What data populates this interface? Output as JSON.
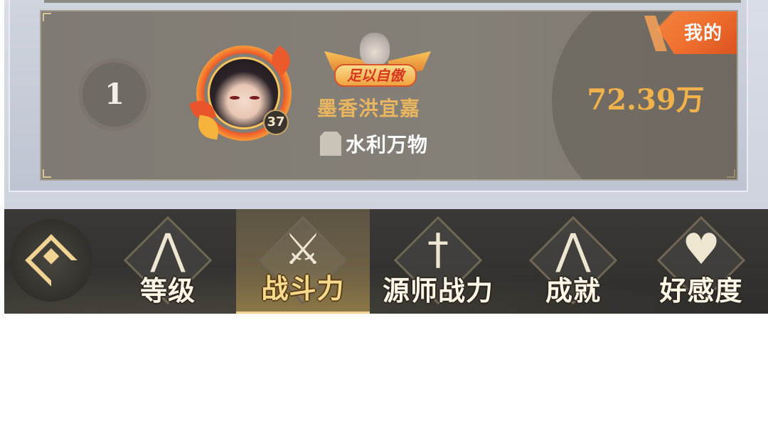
{
  "leaderboard": {
    "my_entry": {
      "mine_label": "我的",
      "rank": "1",
      "level": "37",
      "title_badge": "足以自傲",
      "player_name": "墨香洪宜嘉",
      "guild_name": "水利万物",
      "power_value": "72.39万"
    }
  },
  "tabs": [
    {
      "label": "等级",
      "icon": "level-emblem-icon",
      "active": false
    },
    {
      "label": "战斗力",
      "icon": "crossed-swords-icon",
      "active": true
    },
    {
      "label": "源师战力",
      "icon": "sword-emblem-icon",
      "active": false
    },
    {
      "label": "成就",
      "icon": "achievement-emblem-icon",
      "active": false
    },
    {
      "label": "好感度",
      "icon": "affection-emblem-icon",
      "active": false
    }
  ],
  "colors": {
    "accent_gold": "#f2b24b",
    "mine_flag": "#ef6e2e",
    "name_gold": "#e9b65f"
  }
}
